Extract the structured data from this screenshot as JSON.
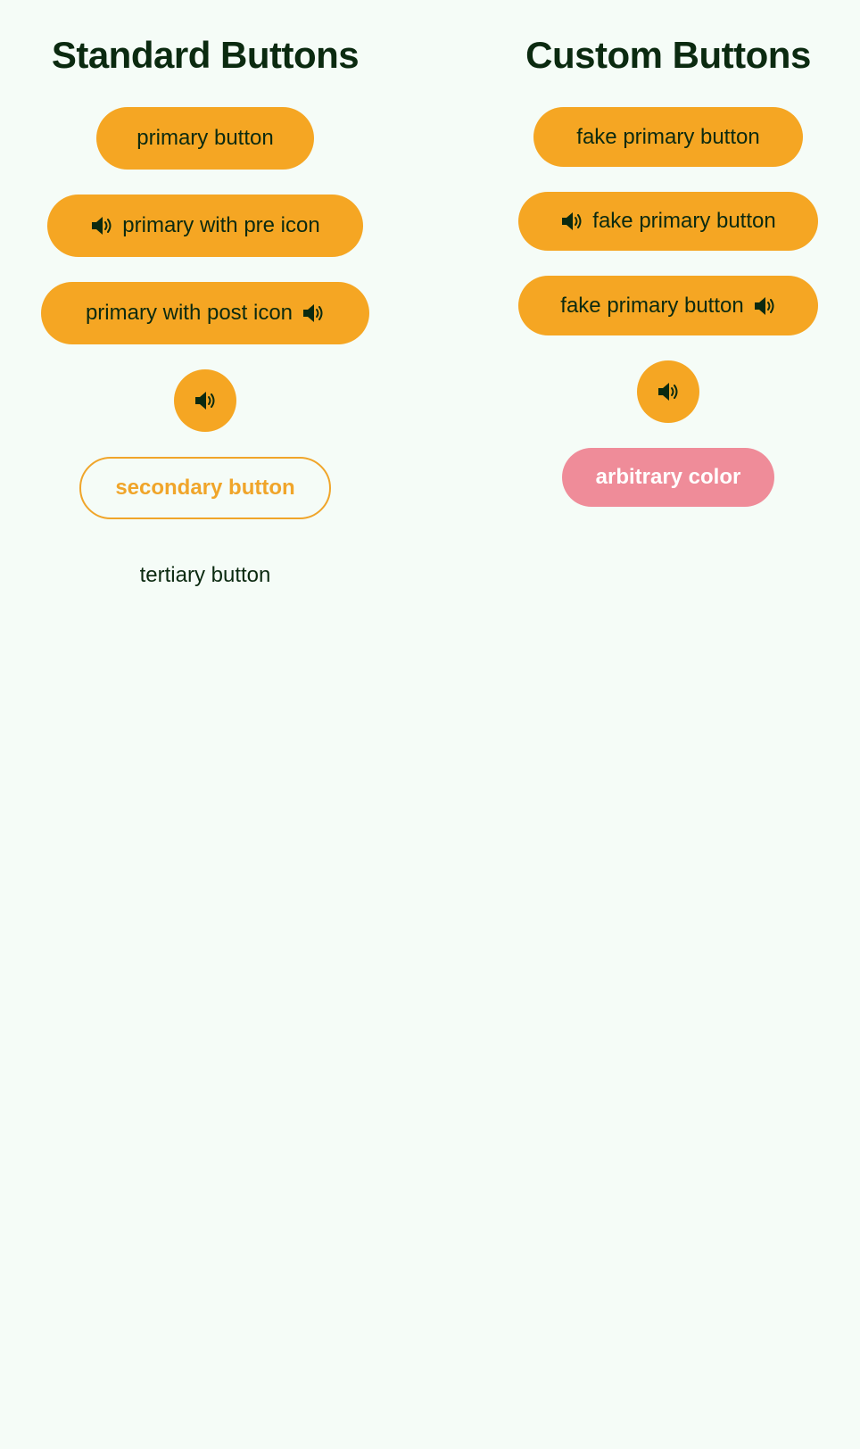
{
  "colors": {
    "background": "#f5fcf7",
    "primary": "#f5a623",
    "text_dark": "#0b2a10",
    "secondary_outline": "#f0a52a",
    "arbitrary": "#ef8c99"
  },
  "standard": {
    "heading": "Standard Buttons",
    "primary_label": "primary button",
    "pre_icon_label": "primary with pre icon",
    "post_icon_label": "primary with post icon",
    "secondary_label": "secondary button",
    "tertiary_label": "tertiary button"
  },
  "custom": {
    "heading": "Custom Buttons",
    "fake_primary_label": "fake primary button",
    "fake_pre_icon_label": "fake primary button",
    "fake_post_icon_label": "fake primary button",
    "arbitrary_label": "arbitrary color"
  },
  "icons": {
    "speaker": "speaker-icon"
  }
}
